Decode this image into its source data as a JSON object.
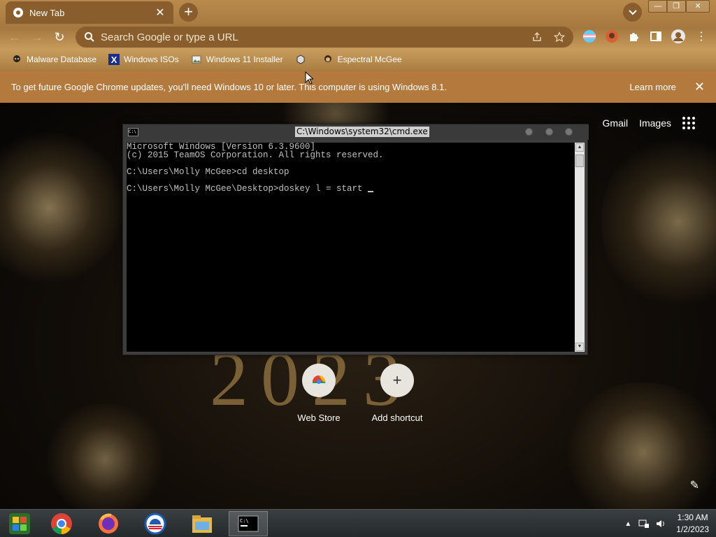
{
  "browser": {
    "tab": {
      "title": "New Tab",
      "close": "✕"
    },
    "new_tab": "+",
    "window_controls": {
      "minimize": "—",
      "restore": "❐",
      "close": "✕"
    },
    "omnibox": {
      "placeholder": "Search Google or type a URL"
    },
    "bookmarks": [
      {
        "label": "Malware Database",
        "icon": "skull-icon"
      },
      {
        "label": "Windows ISOs",
        "icon": "x-icon"
      },
      {
        "label": "Windows 11 Installer",
        "icon": "image-icon"
      },
      {
        "label": "",
        "icon": "cube-icon"
      },
      {
        "label": "Espectral McGee",
        "icon": "avatar-icon"
      }
    ],
    "infobar": {
      "text": "To get future Google Chrome updates, you'll need Windows 10 or later. This computer is using Windows 8.1.",
      "learn_more": "Learn more",
      "close": "✕"
    }
  },
  "ntp": {
    "links": {
      "gmail": "Gmail",
      "images": "Images"
    },
    "year": "2023",
    "shortcuts": [
      {
        "label": "Web Store",
        "icon": "webstore-icon"
      },
      {
        "label": "Add shortcut",
        "icon": "plus-icon"
      }
    ]
  },
  "cmd": {
    "title": "C:\\Windows\\system32\\cmd.exe",
    "lines": [
      "Microsoft Windows [Version 6.3.9600]",
      "(c) 2015 TeamOS Corporation. All rights reserved.",
      "",
      "C:\\Users\\Molly McGee>cd desktop",
      "",
      "C:\\Users\\Molly McGee\\Desktop>doskey l = start "
    ]
  },
  "taskbar": {
    "apps": [
      "windows-8-icon",
      "chrome-icon",
      "firefox-icon",
      "obama-logo-icon",
      "file-explorer-icon",
      "cmd-icon"
    ],
    "clock": {
      "time": "1:30 AM",
      "date": "1/2/2023"
    }
  },
  "colors": {
    "chrome_frame": "#a5783f",
    "infobar": "#b47a3d",
    "taskbar": "#2b3033"
  }
}
